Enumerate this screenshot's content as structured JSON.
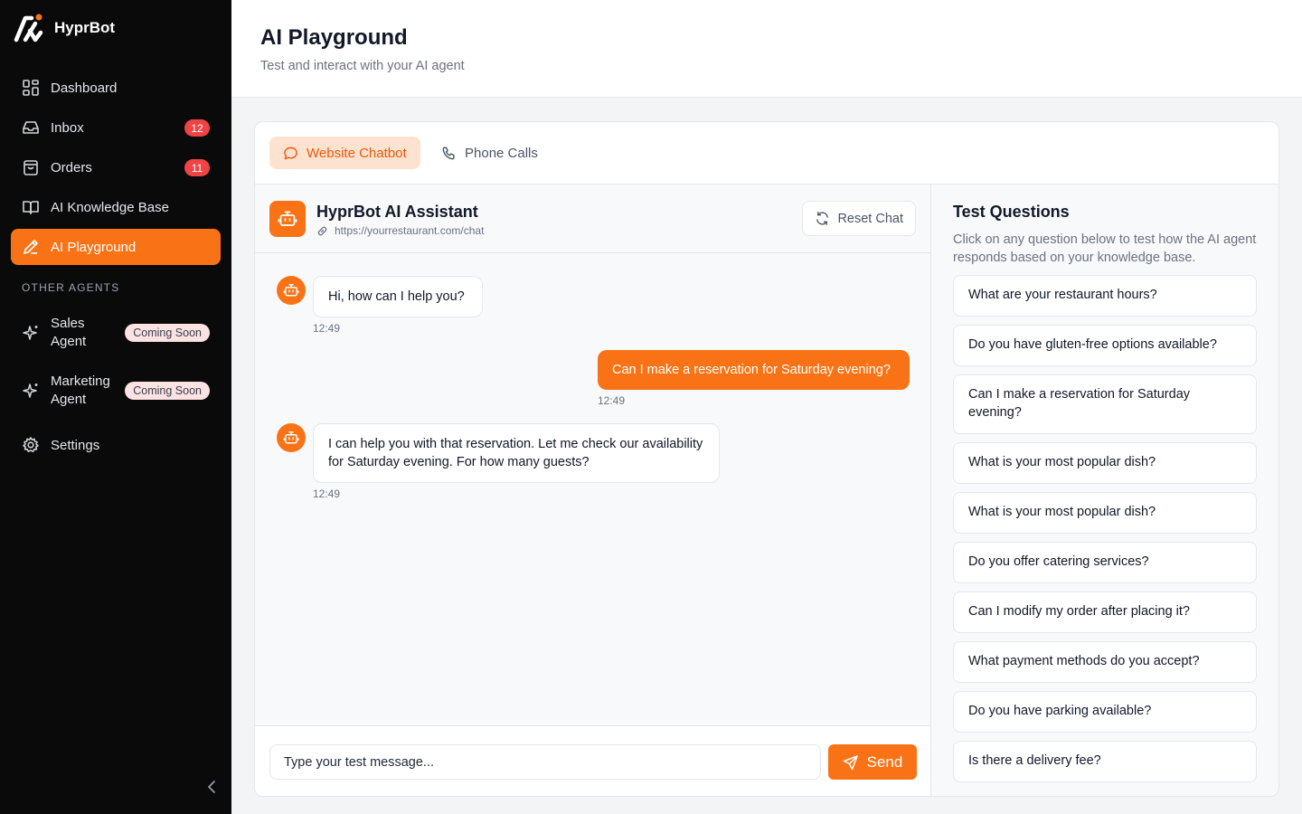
{
  "sidebar": {
    "brand": "HyprBot",
    "nav": [
      {
        "label": "Dashboard",
        "icon": "dashboard-icon"
      },
      {
        "label": "Inbox",
        "icon": "inbox-icon",
        "badge": "12"
      },
      {
        "label": "Orders",
        "icon": "orders-icon",
        "badge": "11"
      },
      {
        "label": "AI Knowledge Base",
        "icon": "book-icon"
      },
      {
        "label": "AI Playground",
        "icon": "pencil-icon",
        "active": true
      }
    ],
    "section_label": "OTHER AGENTS",
    "agents": [
      {
        "label": "Sales Agent",
        "badge": "Coming Soon",
        "icon": "sparkle-icon"
      },
      {
        "label": "Marketing Agent",
        "badge": "Coming Soon",
        "icon": "sparkle-icon"
      }
    ],
    "settings_label": "Settings"
  },
  "header": {
    "title": "AI Playground",
    "subtitle": "Test and interact with your AI agent"
  },
  "tabs": [
    {
      "label": "Website Chatbot",
      "icon": "chat-bubble-icon",
      "active": true
    },
    {
      "label": "Phone Calls",
      "icon": "phone-icon",
      "active": false
    }
  ],
  "chat": {
    "bot_name": "HyprBot AI Assistant",
    "url": "https://yourrestaurant.com/chat",
    "reset_label": "Reset Chat",
    "messages": [
      {
        "role": "bot",
        "text": "Hi, how can I help you?",
        "time": "12:49"
      },
      {
        "role": "user",
        "text": "Can I make a reservation for Saturday evening?",
        "time": "12:49"
      },
      {
        "role": "bot",
        "text": "I can help you with that reservation. Let me check our availability for Saturday evening. For how many guests?",
        "time": "12:49"
      }
    ],
    "input_placeholder": "Type your test message...",
    "send_label": "Send"
  },
  "questions": {
    "title": "Test Questions",
    "description": "Click on any question below to test how the AI agent responds based on your knowledge base.",
    "items": [
      "What are your restaurant hours?",
      "Do you have gluten-free options available?",
      "Can I make a reservation for Saturday evening?",
      "What is your most popular dish?",
      "What is your most popular dish?",
      "Do you offer catering services?",
      "Can I modify my order after placing it?",
      "What payment methods do you accept?",
      "Do you have parking available?",
      "Is there a delivery fee?"
    ]
  },
  "colors": {
    "accent": "#f97316",
    "sidebar_bg": "#0a0a0a",
    "badge_red": "#ef4444"
  }
}
